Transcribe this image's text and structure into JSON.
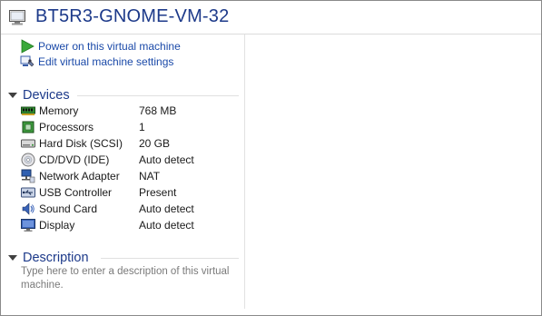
{
  "vm": {
    "name": "BT5R3-GNOME-VM-32"
  },
  "actions": [
    {
      "label": "Power on this virtual machine",
      "icon": "play-icon"
    },
    {
      "label": "Edit virtual machine settings",
      "icon": "settings-icon"
    }
  ],
  "devices": {
    "title": "Devices",
    "items": [
      {
        "name": "Memory",
        "value": "768 MB",
        "icon": "memory-icon"
      },
      {
        "name": "Processors",
        "value": "1",
        "icon": "processor-icon"
      },
      {
        "name": "Hard Disk (SCSI)",
        "value": "20 GB",
        "icon": "hard-disk-icon"
      },
      {
        "name": "CD/DVD (IDE)",
        "value": "Auto detect",
        "icon": "cd-dvd-icon"
      },
      {
        "name": "Network Adapter",
        "value": "NAT",
        "icon": "network-adapter-icon"
      },
      {
        "name": "USB Controller",
        "value": "Present",
        "icon": "usb-controller-icon"
      },
      {
        "name": "Sound Card",
        "value": "Auto detect",
        "icon": "sound-card-icon"
      },
      {
        "name": "Display",
        "value": "Auto detect",
        "icon": "display-icon"
      }
    ]
  },
  "description": {
    "title": "Description",
    "placeholder": "Type here to enter a description of this virtual machine."
  },
  "colors": {
    "accent": "#1d3a8a",
    "link": "#1a49a8",
    "play_green": "#3aa83a"
  }
}
